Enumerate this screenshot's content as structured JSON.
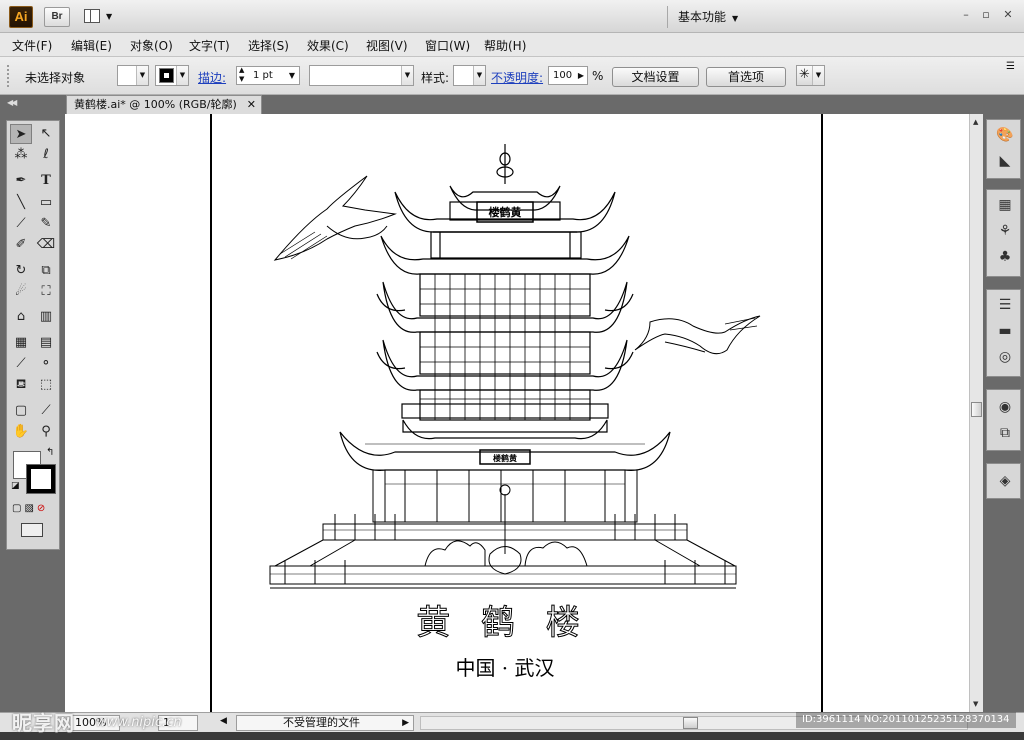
{
  "app": {
    "logo_text": "Ai",
    "bridge_text": "Br",
    "workspace": "基本功能",
    "window_controls": {
      "minimize": "–",
      "restore": "▫",
      "close": "✕"
    }
  },
  "menu": [
    "文件(F)",
    "编辑(E)",
    "对象(O)",
    "文字(T)",
    "选择(S)",
    "效果(C)",
    "视图(V)",
    "窗口(W)",
    "帮助(H)"
  ],
  "control_bar": {
    "selection_status": "未选择对象",
    "stroke_label": "描边:",
    "stroke_weight": "1 pt",
    "style_label": "样式:",
    "opacity_label": "不透明度:",
    "opacity_value": "100",
    "opacity_unit": "%",
    "doc_setup_button": "文档设置",
    "preferences_button": "首选项"
  },
  "document_tab": {
    "title": "黄鹤楼.ai* @ 100% (RGB/轮廓)",
    "close": "✕"
  },
  "artwork": {
    "title": "黄 鹤 楼",
    "subtitle": "中国 · 武汉",
    "top_plaque": "楼鹤黄",
    "lower_plaque": "楼鹤黄"
  },
  "status_bar": {
    "zoom": "100%",
    "page": "1",
    "status_text": "不受管理的文件"
  },
  "watermark": {
    "text": "昵享网",
    "url": "www.nipic.cn",
    "image_id": "ID:3961114 NO:20110125235128370134"
  },
  "tools": [
    "selection-tool",
    "direct-selection-tool",
    "magic-wand-tool",
    "lasso-tool",
    "pen-tool",
    "type-tool",
    "line-tool",
    "rectangle-tool",
    "paintbrush-tool",
    "pencil-tool",
    "blob-brush-tool",
    "eraser-tool",
    "rotate-tool",
    "scale-tool",
    "warp-tool",
    "free-transform-tool",
    "symbol-sprayer-tool",
    "column-graph-tool",
    "mesh-tool",
    "gradient-tool",
    "eyedropper-tool",
    "blend-tool",
    "live-paint-bucket-tool",
    "live-paint-selection-tool",
    "artboard-tool",
    "slice-tool",
    "hand-tool",
    "zoom-tool"
  ]
}
